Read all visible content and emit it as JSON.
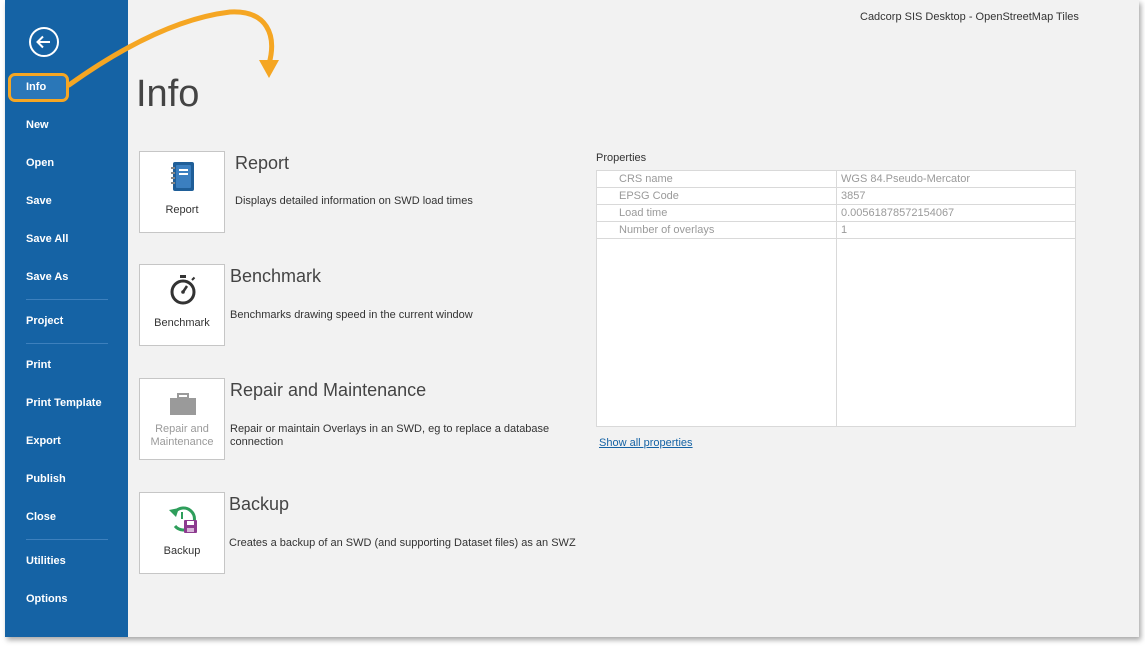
{
  "window": {
    "title": "Cadcorp SIS Desktop - OpenStreetMap Tiles"
  },
  "sidebar": {
    "items": [
      {
        "label": "Info"
      },
      {
        "label": "New"
      },
      {
        "label": "Open"
      },
      {
        "label": "Save"
      },
      {
        "label": "Save All"
      },
      {
        "label": "Save As"
      },
      {
        "label": "Project"
      },
      {
        "label": "Print"
      },
      {
        "label": "Print Template"
      },
      {
        "label": "Export"
      },
      {
        "label": "Publish"
      },
      {
        "label": "Close"
      },
      {
        "label": "Utilities"
      },
      {
        "label": "Options"
      }
    ]
  },
  "main": {
    "heading": "Info",
    "actions": [
      {
        "button_label": "Report",
        "title": "Report",
        "description": "Displays detailed information on SWD load times",
        "icon": "notebook-icon"
      },
      {
        "button_label": "Benchmark",
        "title": "Benchmark",
        "description": "Benchmarks drawing speed in the current window",
        "icon": "stopwatch-icon"
      },
      {
        "button_label": "Repair and Maintenance",
        "title": "Repair and Maintenance",
        "description": "Repair or maintain Overlays in an SWD, eg to replace a database connection",
        "icon": "toolbox-icon"
      },
      {
        "button_label": "Backup",
        "title": "Backup",
        "description": "Creates a backup of an SWD (and supporting Dataset files) as an SWZ",
        "icon": "backup-icon"
      }
    ]
  },
  "properties": {
    "heading": "Properties",
    "rows": [
      {
        "key": "CRS name",
        "value": "WGS 84.Pseudo-Mercator"
      },
      {
        "key": "EPSG Code",
        "value": "3857"
      },
      {
        "key": "Load time",
        "value": "0.00561878572154067"
      },
      {
        "key": "Number of overlays",
        "value": "1"
      }
    ],
    "show_all": "Show all properties"
  },
  "colors": {
    "sidebar": "#1563a5",
    "highlight": "#f5a623",
    "link": "#1563a5"
  }
}
